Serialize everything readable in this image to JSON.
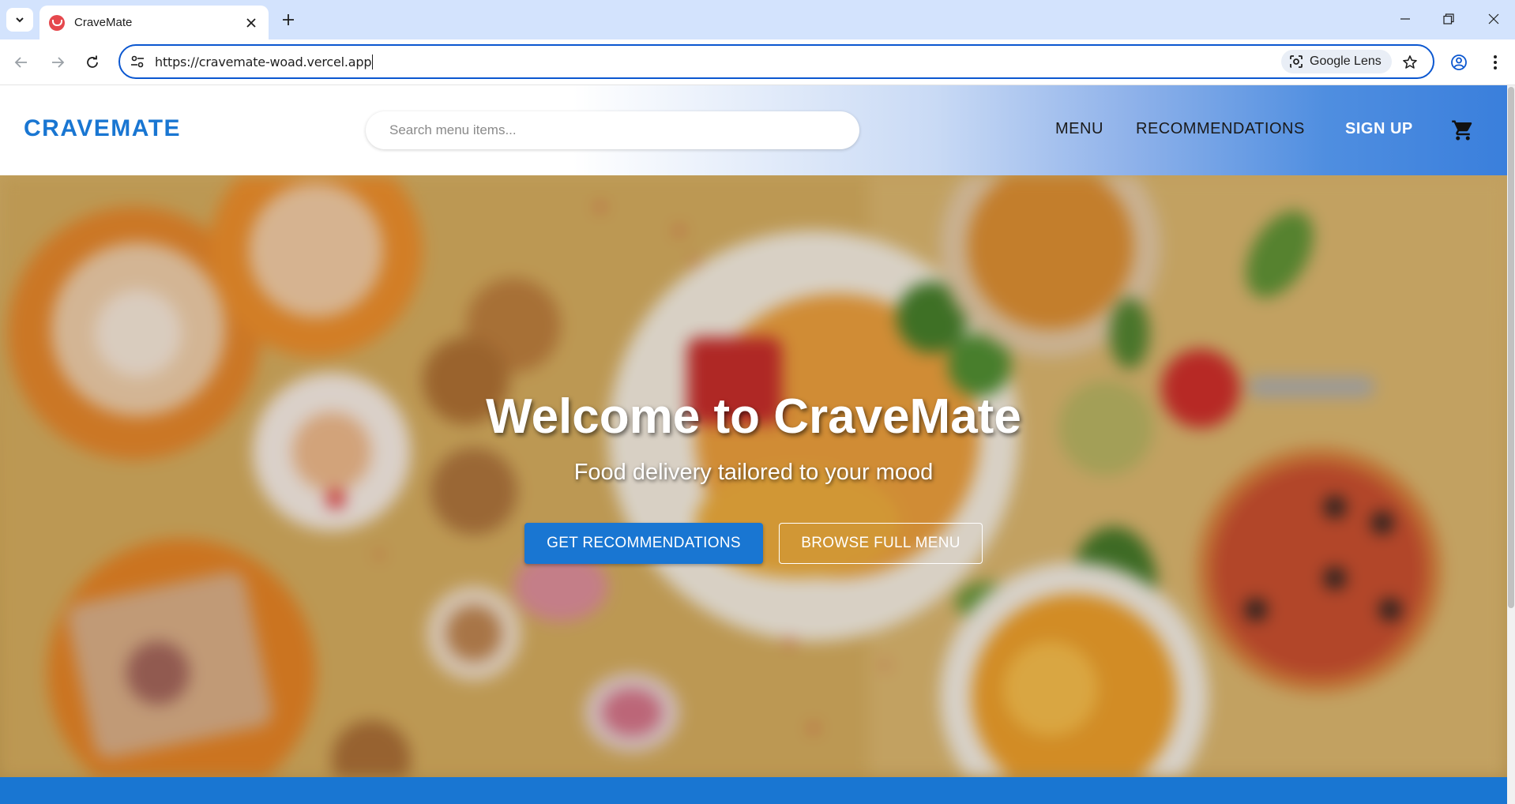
{
  "browser": {
    "tab_title": "CraveMate",
    "url": "https://cravemate-woad.vercel.app",
    "lens_label": "Google Lens",
    "accent": "#0b57d0",
    "tabstrip_color": "#d3e3fd"
  },
  "header": {
    "logo": "CRAVEMATE",
    "search_placeholder": "Search menu items...",
    "nav": {
      "menu": "MENU",
      "recommendations": "RECOMMENDATIONS",
      "signup": "SIGN UP"
    },
    "cart_icon": "shopping-cart-icon"
  },
  "hero": {
    "title": "Welcome to CraveMate",
    "subtitle": "Food delivery tailored to your mood",
    "primary_button": "GET RECOMMENDATIONS",
    "secondary_button": "BROWSE FULL MENU"
  },
  "colors": {
    "brand_blue": "#1976d2",
    "white": "#ffffff"
  }
}
